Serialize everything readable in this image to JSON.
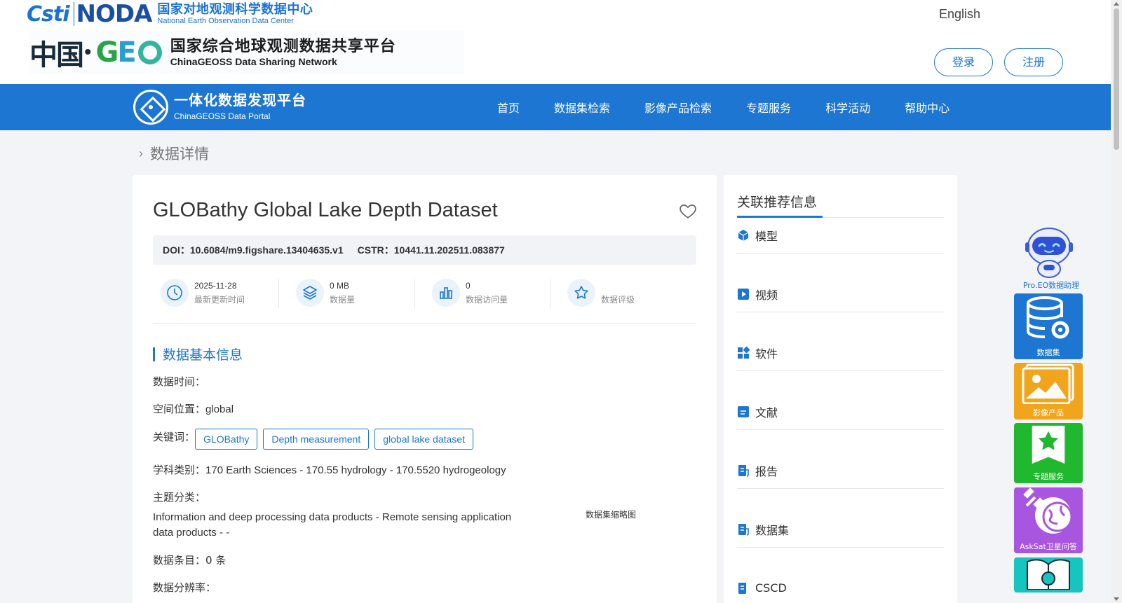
{
  "header": {
    "logo1": {
      "cstr": "Csti",
      "noda": "NODA",
      "cn": "国家对地观测科学数据中心",
      "en": "National Earth Observation Data Center"
    },
    "logo2": {
      "china": "中国",
      "cn": "国家综合地球观测数据共享平台",
      "en": "ChinaGEOSS Data Sharing Network"
    },
    "language": "English",
    "login": "登录",
    "register": "注册"
  },
  "nav": {
    "portal_cn": "一体化数据发现平台",
    "portal_en": "ChinaGEOSS Data Portal",
    "items": [
      "首页",
      "数据集检索",
      "影像产品检索",
      "专题服务",
      "科学活动",
      "帮助中心"
    ]
  },
  "breadcrumb": "数据详情",
  "dataset": {
    "title": "GLOBathy Global Lake Depth Dataset",
    "doi_label": "DOI：",
    "doi": "10.6084/m9.figshare.13404635.v1",
    "cstr_label": "CSTR：",
    "cstr": "10441.11.202511.083877",
    "stats": [
      {
        "icon": "clock-icon",
        "value": "2025-11-28",
        "label": "最新更新时间"
      },
      {
        "icon": "layers-icon",
        "value": "0 MB",
        "label": "数据量"
      },
      {
        "icon": "bar-chart-icon",
        "value": "0",
        "label": "数据访问量"
      },
      {
        "icon": "star-icon",
        "value": "",
        "label": "数据评级"
      }
    ]
  },
  "basic_info": {
    "section_title": "数据基本信息",
    "data_time_label": "数据时间：",
    "data_time": "",
    "location_label": "空间位置：",
    "location": "global",
    "keywords_label": "关键词：",
    "keywords": [
      "GLOBathy",
      "Depth measurement",
      "global lake dataset"
    ],
    "discipline_label": "学科类别：",
    "discipline": "170 Earth Sciences - 170.55 hydrology - 170.5520 hydrogeology",
    "theme_label": "主题分类：",
    "theme": "Information and deep processing data products - Remote sensing application data products - -",
    "entries_label": "数据条目：",
    "entries": "0 条",
    "resolution_label": "数据分辨率：",
    "thumbnail_label": "数据集缩略图"
  },
  "related": {
    "title": "关联推荐信息",
    "items": [
      {
        "icon": "cube-icon",
        "label": "模型"
      },
      {
        "icon": "video-play-icon",
        "label": "视频"
      },
      {
        "icon": "apps-icon",
        "label": "软件"
      },
      {
        "icon": "document-icon",
        "label": "文献"
      },
      {
        "icon": "report-icon",
        "label": "报告"
      },
      {
        "icon": "dataset-icon",
        "label": "数据集"
      },
      {
        "icon": "cscd-icon",
        "label": "CSCD"
      }
    ]
  },
  "float_bar": {
    "assistant": "Pro.EO数据助理",
    "tiles": [
      {
        "label": "数据集",
        "color": "#1c76d2",
        "icon": "database-gear-icon"
      },
      {
        "label": "影像产品",
        "color": "#f0a51c",
        "icon": "image-icon"
      },
      {
        "label": "专题服务",
        "color": "#1fb82e",
        "icon": "star-badge-icon"
      },
      {
        "label": "AskSat卫星问答",
        "color": "#a855e0",
        "icon": "satellite-icon"
      },
      {
        "label": "",
        "color": "#16c4c0",
        "icon": "book-icon"
      }
    ]
  },
  "colors": {
    "primary": "#1c76d2",
    "background": "#f2f4f7"
  }
}
